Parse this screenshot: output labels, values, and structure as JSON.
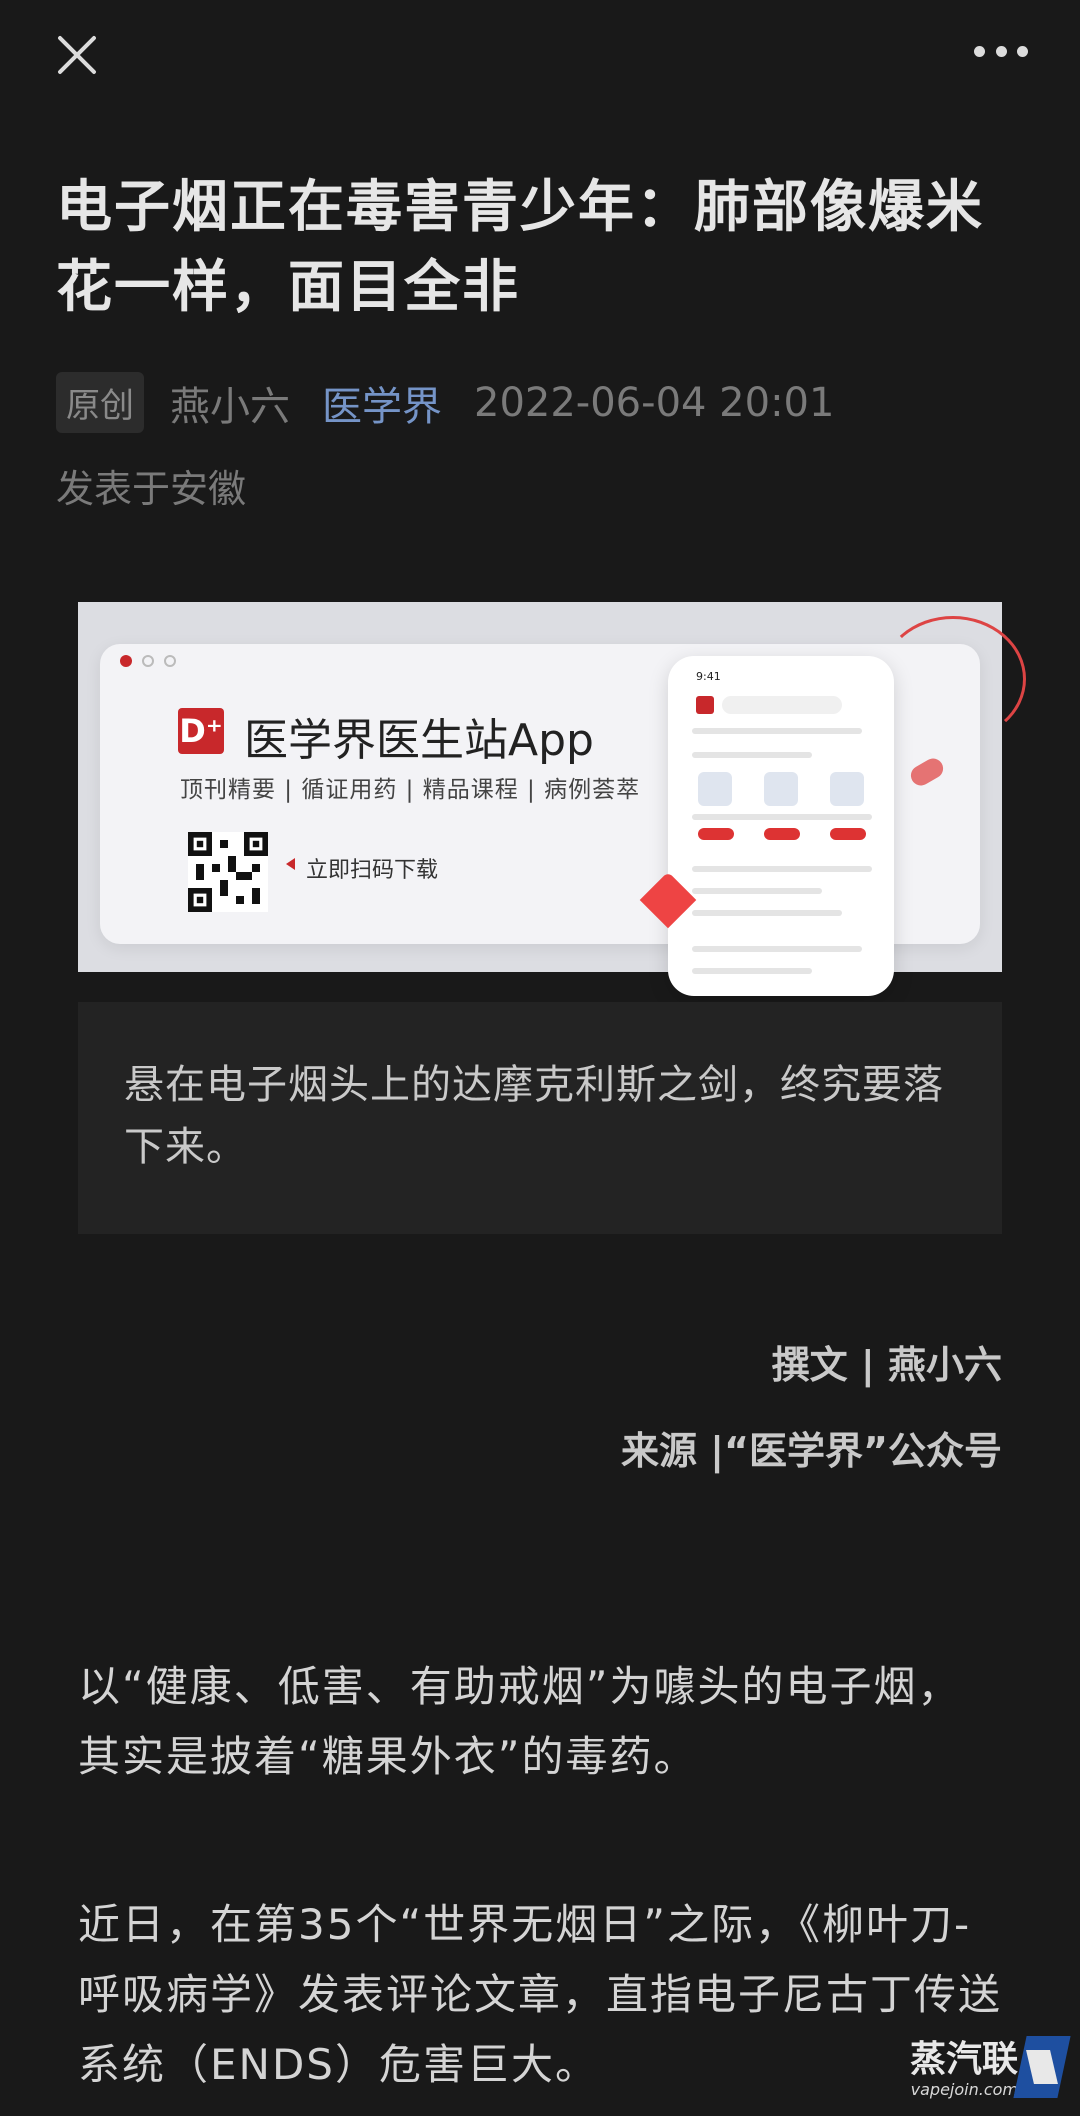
{
  "article": {
    "title": "电子烟正在毒害青少年：肺部像爆米花一样，面目全非",
    "original_badge": "原创",
    "author": "燕小六",
    "account": "医学界",
    "datetime": "2022-06-04 20:01",
    "location": "发表于安徽"
  },
  "banner": {
    "app_name": "医学界医生站App",
    "logo_text": "D⁺",
    "tags": "顶刊精要 | 循证用药 | 精品课程 | 病例荟萃",
    "scan_text": "立即扫码下载",
    "phone_time": "9:41"
  },
  "quote": "悬在电子烟头上的达摩克利斯之剑，终究要落下来。",
  "credits": {
    "writer": "撰文 | 燕小六",
    "source": "来源 |“医学界”公众号"
  },
  "paragraphs": [
    "以“健康、低害、有助戒烟”为噱头的电子烟，其实是披着“糖果外衣”的毒药。",
    "近日，在第35个“世界无烟日”之际，《柳叶刀-呼吸病学》发表评论文章，直指电子尼古丁传送系统（ENDS）危害巨大。"
  ],
  "watermark": {
    "name": "蒸汽联",
    "url": "vapejoin.com"
  },
  "colors": {
    "background": "#191919",
    "accent_link": "#7594c7",
    "brand_red": "#c8282b"
  }
}
